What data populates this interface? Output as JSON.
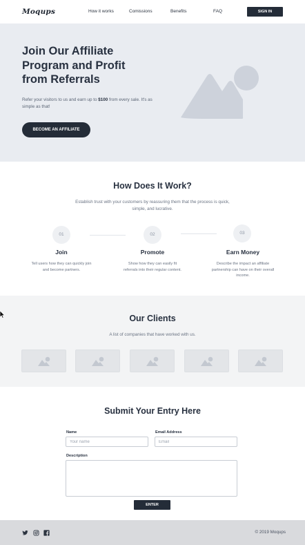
{
  "nav": {
    "logo": "Moqups",
    "links": [
      "How it works",
      "Comissions",
      "Benefits",
      "FAQ"
    ],
    "signin_label": "SIGN IN"
  },
  "hero": {
    "title": "Join Our Affiliate Program and Profit from Referrals",
    "text_before": "Refer your visitors to us and earn up to ",
    "text_amount": "$100",
    "text_after": " from every sale. It's as simple as that!",
    "button_label": "BECOME AN AFFILIATE"
  },
  "how": {
    "title": "How Does It Work?",
    "subtitle": "Establish trust with your customers by reassuring them that the process is quick, simple, and lucrative.",
    "steps": [
      {
        "num": "01",
        "title": "Join",
        "desc": "Tell users how they can quickly join and become partners."
      },
      {
        "num": "02",
        "title": "Promote",
        "desc": "Show how they can easily fit referrals into their regular content."
      },
      {
        "num": "03",
        "title": "Earn Money",
        "desc": "Describe the impact an affiliate partnership can have on their overall income."
      }
    ]
  },
  "clients": {
    "title": "Our Clients",
    "subtitle": "A list of companies that have worked with us.",
    "logo_count_icon": "image-placeholder-icon"
  },
  "form": {
    "title": "Submit Your Entry Here",
    "name_label": "Name",
    "name_placeholder": "Your name",
    "email_label": "Email Address",
    "email_placeholder": "Email",
    "description_label": "Description",
    "submit_label": "ENTER"
  },
  "footer": {
    "icons": [
      "twitter-icon",
      "instagram-icon",
      "facebook-icon"
    ],
    "copyright": "© 2019 Moqups"
  },
  "colors": {
    "accent": "#242c38",
    "hero_bg": "#e9ecf1",
    "clients_bg": "#f3f4f5",
    "footer_bg": "#d9dadd"
  }
}
